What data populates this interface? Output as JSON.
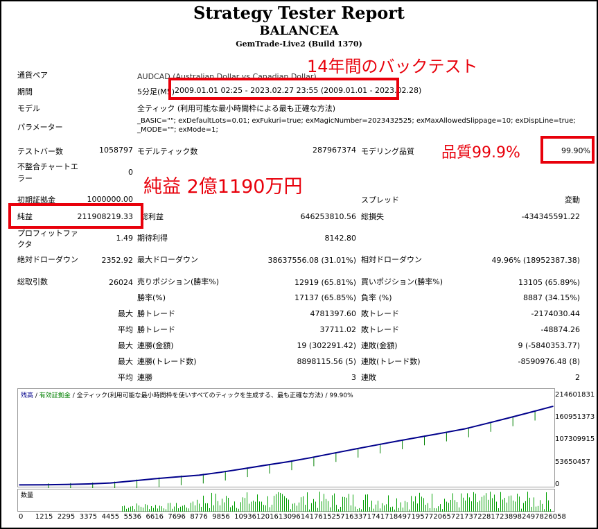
{
  "header": {
    "title": "Strategy Tester Report",
    "ea_name": "BALANCEA",
    "server": "GemTrade-Live2 (Build 1370)"
  },
  "annotations": {
    "years_test": "14年間のバックテスト",
    "quality": "品質99.9%",
    "net_profit": "純益 2億1190万円"
  },
  "info": {
    "symbol_label": "通貨ペア",
    "symbol_value": "AUDCAD (Australian Dollar vs Canadian Dollar)",
    "period_label": "期間",
    "period_prefix": "5分足(M5)",
    "period_value": "2009.01.01 02:25 - 2023.02.27 23:55 (2009.01.01 - 2023.02.28)",
    "model_label": "モデル",
    "model_value": "全ティック (利用可能な最小時間枠による最も正確な方法)",
    "params_label": "パラメーター",
    "params_line1": "_BASIC=\"\"; exDefaultLots=0.01; exFukuri=true; exMagicNumber=2023432525; exMaxAllowedSlippage=10; exDispLine=true;",
    "params_line2": "_MODE=\"\"; exMode=1;"
  },
  "stats": {
    "bars_label": "テストバー数",
    "bars_value": "1058797",
    "ticks_label": "モデルティック数",
    "ticks_value": "287967374",
    "quality_label": "モデリング品質",
    "quality_value": "99.90%",
    "mismatch_label_1": "不整合チャートエ",
    "mismatch_label_2": "ラー",
    "mismatch_value": "0",
    "deposit_label": "初期証拠金",
    "deposit_value": "1000000.00",
    "spread_label": "スプレッド",
    "spread_value": "変動",
    "net_label": "純益",
    "net_value": "211908219.33",
    "gross_profit_label": "総利益",
    "gross_profit_value": "646253810.56",
    "gross_loss_label": "総損失",
    "gross_loss_value": "-434345591.22",
    "pf_label_1": "プロフィットファ",
    "pf_label_2": "クタ",
    "pf_value": "1.49",
    "expected_label": "期待利得",
    "expected_value": "8142.80",
    "abs_dd_label": "絶対ドローダウン",
    "abs_dd_value": "2352.92",
    "max_dd_label": "最大ドローダウン",
    "max_dd_value": "38637556.08 (31.01%)",
    "rel_dd_label": "相対ドローダウン",
    "rel_dd_value": "49.96% (18952387.38)",
    "trades_label": "総取引数",
    "trades_value": "26024",
    "short_label": "売りポジション(勝率%)",
    "short_value": "12919 (65.81%)",
    "long_label": "買いポジション(勝率%)",
    "long_value": "13105 (65.89%)",
    "win_label": "勝率(%)",
    "win_value": "17137 (65.85%)",
    "loss_label": "負率 (%)",
    "loss_value": "8887 (34.15%)",
    "max_word": "最大",
    "avg_word": "平均",
    "largest_win_label": "勝トレード",
    "largest_win_value": "4781397.60",
    "largest_loss_label": "敗トレード",
    "largest_loss_value": "-2174030.44",
    "avg_win_label": "勝トレード",
    "avg_win_value": "37711.02",
    "avg_loss_label": "敗トレード",
    "avg_loss_value": "-48874.26",
    "max_cons_win_label": "連勝(金額)",
    "max_cons_win_value": "19 (302291.42)",
    "max_cons_loss_label": "連敗(金額)",
    "max_cons_loss_value": "9 (-5840353.77)",
    "max_cons_profit_label": "連勝(トレード数)",
    "max_cons_profit_value": "8898115.56 (5)",
    "max_cons_lossamt_label": "連敗(トレード数)",
    "max_cons_lossamt_value": "-8590976.48 (8)",
    "avg_cons_win_label": "連勝",
    "avg_cons_win_value": "3",
    "avg_cons_loss_label": "連敗",
    "avg_cons_loss_value": "2"
  },
  "chart": {
    "legend_balance": "残高",
    "legend_equity": "有効証拠金",
    "legend_rest": "全ティック(利用可能な最小時間枠を使いすべてのティックを生成する、最も正確な方法)",
    "legend_quality": "99.90%",
    "volume_label": "数量",
    "y_ticks": [
      "214601831",
      "160951373",
      "107309915",
      "53650457",
      "0"
    ],
    "x_ticks": [
      "0",
      "1215",
      "2295",
      "3375",
      "4455",
      "5536",
      "6616",
      "7696",
      "8776",
      "9856",
      "10936",
      "12016",
      "13096",
      "14176",
      "15257",
      "16337",
      "17417",
      "18497",
      "19577",
      "20657",
      "21737",
      "22817",
      "23898",
      "24978",
      "26058"
    ]
  },
  "chart_data": {
    "type": "line",
    "xlabel": "",
    "ylabel": "",
    "xlim": [
      0,
      26058
    ],
    "ylim": [
      0,
      214601831
    ],
    "series": [
      {
        "name": "残高",
        "x": [
          0,
          1215,
          2295,
          3375,
          4455,
          5536,
          6616,
          7696,
          8776,
          9856,
          10936,
          12016,
          13096,
          14176,
          15257,
          16337,
          17417,
          18497,
          19577,
          20657,
          21737,
          22817,
          23898,
          24978,
          26058
        ],
        "values": [
          1000000,
          1300000,
          2000000,
          3400000,
          5700000,
          10700000,
          15800000,
          20200000,
          24400000,
          31500000,
          39800000,
          48200000,
          56300000,
          65800000,
          76200000,
          86500000,
          96600000,
          106500000,
          116000000,
          125500000,
          135300000,
          148400000,
          161800000,
          175500000,
          189500000
        ]
      }
    ]
  }
}
